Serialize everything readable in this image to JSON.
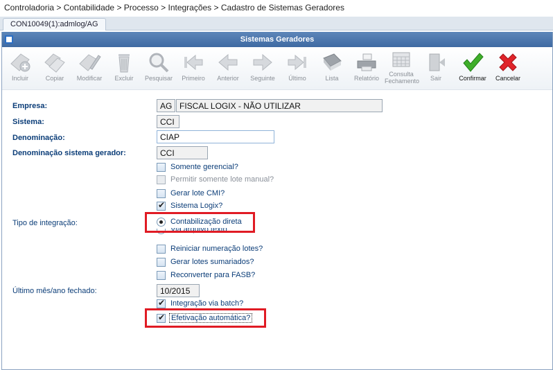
{
  "breadcrumb": "Controladoria > Contabilidade > Processo > Integrações > Cadastro de Sistemas Geradores",
  "tab": {
    "label": "CON10049(1):admlog/AG"
  },
  "window": {
    "title": "Sistemas Geradores"
  },
  "toolbar": [
    {
      "label": "Incluir",
      "icon": "include-icon",
      "enabled": false
    },
    {
      "label": "Copiar",
      "icon": "copy-icon",
      "enabled": false
    },
    {
      "label": "Modificar",
      "icon": "edit-icon",
      "enabled": false
    },
    {
      "label": "Excluir",
      "icon": "trash-icon",
      "enabled": false
    },
    {
      "label": "Pesquisar",
      "icon": "search-icon",
      "enabled": false
    },
    {
      "label": "Primeiro",
      "icon": "first-icon",
      "enabled": false
    },
    {
      "label": "Anterior",
      "icon": "previous-icon",
      "enabled": false
    },
    {
      "label": "Seguinte",
      "icon": "next-icon",
      "enabled": false
    },
    {
      "label": "Último",
      "icon": "last-icon",
      "enabled": false
    },
    {
      "label": "Lista",
      "icon": "book-icon",
      "enabled": false
    },
    {
      "label": "Relatório",
      "icon": "printer-icon",
      "enabled": false
    },
    {
      "label": "Consulta Fechamento",
      "icon": "calendar-icon",
      "enabled": false
    },
    {
      "label": "Sair",
      "icon": "exit-icon",
      "enabled": false
    },
    {
      "label": "Confirmar",
      "icon": "checkmark-icon",
      "enabled": true
    },
    {
      "label": "Cancelar",
      "icon": "cancel-icon",
      "enabled": true
    }
  ],
  "form": {
    "empresa": {
      "label": "Empresa:",
      "code": "AG",
      "name": "FISCAL LOGIX - NÃO UTILIZAR"
    },
    "sistema": {
      "label": "Sistema:",
      "value": "CCI"
    },
    "denominacao": {
      "label": "Denominação:",
      "value": "CIAP"
    },
    "denominacao_gerador": {
      "label": "Denominação sistema gerador:",
      "value": "CCI"
    },
    "checks1": [
      {
        "label": "Somente gerencial?",
        "checked": false,
        "disabled": false
      },
      {
        "label": "Permitir somente lote manual?",
        "checked": false,
        "disabled": true
      },
      {
        "label": "Gerar lote CMI?",
        "checked": false,
        "disabled": false
      },
      {
        "label": "Sistema Logix?",
        "checked": true,
        "disabled": false
      }
    ],
    "tipo_integracao": {
      "label": "Tipo de integração:",
      "options": [
        {
          "label": "Contabilização direta",
          "selected": true
        },
        {
          "label": "Via arquivo texto",
          "selected": false
        }
      ]
    },
    "checks2": [
      {
        "label": "Reiniciar numeração lotes?",
        "checked": false
      },
      {
        "label": "Gerar lotes sumariados?",
        "checked": false
      },
      {
        "label": "Reconverter para FASB?",
        "checked": false
      }
    ],
    "ultimo_mes": {
      "label": "Último mês/ano fechado:",
      "value": "10/2015"
    },
    "checks3": [
      {
        "label": "Integração via batch?",
        "checked": true
      },
      {
        "label": "Efetivação automática?",
        "checked": true
      }
    ]
  },
  "check_glyph": "✔",
  "highlight_color": "#e01b24"
}
